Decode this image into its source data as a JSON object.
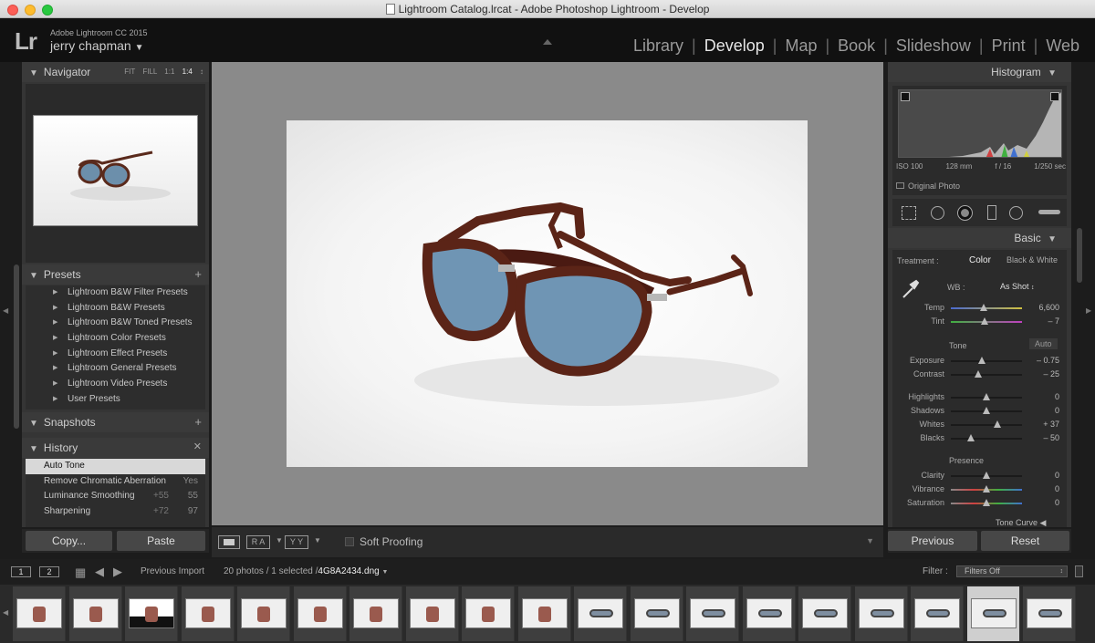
{
  "window": {
    "title": "Lightroom Catalog.lrcat - Adobe Photoshop Lightroom - Develop"
  },
  "identity": {
    "logo": "Lr",
    "app": "Adobe Lightroom CC 2015",
    "user": "jerry chapman"
  },
  "modules": [
    "Library",
    "Develop",
    "Map",
    "Book",
    "Slideshow",
    "Print",
    "Web"
  ],
  "active_module": "Develop",
  "navigator": {
    "title": "Navigator",
    "zoom": [
      "FIT",
      "FILL",
      "1:1",
      "1:4"
    ],
    "zoom_selected": "1:4"
  },
  "presets": {
    "title": "Presets",
    "items": [
      "Lightroom B&W Filter Presets",
      "Lightroom B&W Presets",
      "Lightroom B&W Toned Presets",
      "Lightroom Color Presets",
      "Lightroom Effect Presets",
      "Lightroom General Presets",
      "Lightroom Video Presets",
      "User Presets"
    ]
  },
  "snapshots": {
    "title": "Snapshots"
  },
  "history": {
    "title": "History",
    "items": [
      {
        "label": "Auto Tone",
        "a": "",
        "b": ""
      },
      {
        "label": "Remove Chromatic Aberration",
        "a": "",
        "b": "Yes"
      },
      {
        "label": "Luminance Smoothing",
        "a": "+55",
        "b": "55"
      },
      {
        "label": "Sharpening",
        "a": "+72",
        "b": "97"
      }
    ]
  },
  "left_buttons": {
    "copy": "Copy...",
    "paste": "Paste"
  },
  "toolbar": {
    "soft_proofing": "Soft Proofing",
    "ra": "R A",
    "yy": "Y Y"
  },
  "histogram": {
    "title": "Histogram",
    "iso": "ISO 100",
    "focal": "128 mm",
    "aperture": "f / 16",
    "shutter": "1/250 sec",
    "original_photo": "Original Photo"
  },
  "basic": {
    "title": "Basic",
    "treatment_label": "Treatment :",
    "color": "Color",
    "bw": "Black & White",
    "wb_label": "WB :",
    "wb_value": "As Shot",
    "tone_label": "Tone",
    "auto": "Auto",
    "presence_label": "Presence",
    "sliders": [
      {
        "label": "Temp",
        "value": "6,600",
        "pos": 0.46
      },
      {
        "label": "Tint",
        "value": "– 7",
        "pos": 0.48
      },
      {
        "label": "Exposure",
        "value": "– 0.75",
        "pos": 0.44
      },
      {
        "label": "Contrast",
        "value": "– 25",
        "pos": 0.38
      },
      {
        "label": "Highlights",
        "value": "0",
        "pos": 0.5
      },
      {
        "label": "Shadows",
        "value": "0",
        "pos": 0.5
      },
      {
        "label": "Whites",
        "value": "+ 37",
        "pos": 0.66
      },
      {
        "label": "Blacks",
        "value": "– 50",
        "pos": 0.28
      },
      {
        "label": "Clarity",
        "value": "0",
        "pos": 0.5
      },
      {
        "label": "Vibrance",
        "value": "0",
        "pos": 0.5
      },
      {
        "label": "Saturation",
        "value": "0",
        "pos": 0.5
      }
    ],
    "next_panel": "Tone Curve"
  },
  "right_buttons": {
    "previous": "Previous",
    "reset": "Reset"
  },
  "filmstrip_bar": {
    "page1": "1",
    "page2": "2",
    "source": "Previous Import",
    "count": "20 photos / 1 selected /",
    "filename": "4G8A2434.dng",
    "filter_label": "Filter :",
    "filter_value": "Filters Off"
  },
  "filmstrip": {
    "thumbs": [
      "boot",
      "boot",
      "boot-dark",
      "boot",
      "boot",
      "boot",
      "boot",
      "boot",
      "boot",
      "boot",
      "glasses",
      "glasses",
      "glasses",
      "glasses",
      "glasses",
      "glasses",
      "glasses",
      "glasses",
      "glasses"
    ],
    "selected_index": 17
  }
}
